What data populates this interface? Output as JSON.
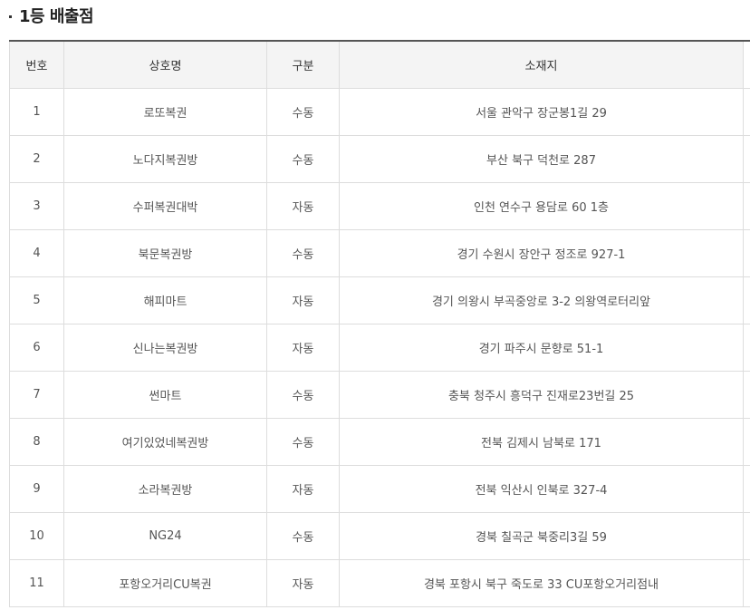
{
  "section": {
    "title": "1등 배출점"
  },
  "table": {
    "headers": [
      "번호",
      "상호명",
      "구분",
      "소재지"
    ],
    "rows": [
      {
        "no": "1",
        "name": "로또복권",
        "type": "수동",
        "address": "서울 관악구 장군봉1길 29"
      },
      {
        "no": "2",
        "name": "노다지복권방",
        "type": "수동",
        "address": "부산 북구 덕천로 287"
      },
      {
        "no": "3",
        "name": "수퍼복권대박",
        "type": "자동",
        "address": "인천 연수구 용담로 60 1층"
      },
      {
        "no": "4",
        "name": "북문복권방",
        "type": "수동",
        "address": "경기 수원시 장안구 정조로 927-1"
      },
      {
        "no": "5",
        "name": "해피마트",
        "type": "자동",
        "address": "경기 의왕시 부곡중앙로 3-2 의왕역로터리앞"
      },
      {
        "no": "6",
        "name": "신나는복권방",
        "type": "자동",
        "address": "경기 파주시 문향로 51-1"
      },
      {
        "no": "7",
        "name": "썬마트",
        "type": "수동",
        "address": "충북 청주시 흥덕구 진재로23번길 25"
      },
      {
        "no": "8",
        "name": "여기있었네복권방",
        "type": "수동",
        "address": "전북 김제시 남북로 171"
      },
      {
        "no": "9",
        "name": "소라복권방",
        "type": "자동",
        "address": "전북 익산시 인북로 327-4"
      },
      {
        "no": "10",
        "name": "NG24",
        "type": "수동",
        "address": "경북 칠곡군 북중리3길 59"
      },
      {
        "no": "11",
        "name": "포항오거리CU복권",
        "type": "자동",
        "address": "경북 포항시 북구 죽도로 33 CU포항오거리점내"
      }
    ]
  }
}
